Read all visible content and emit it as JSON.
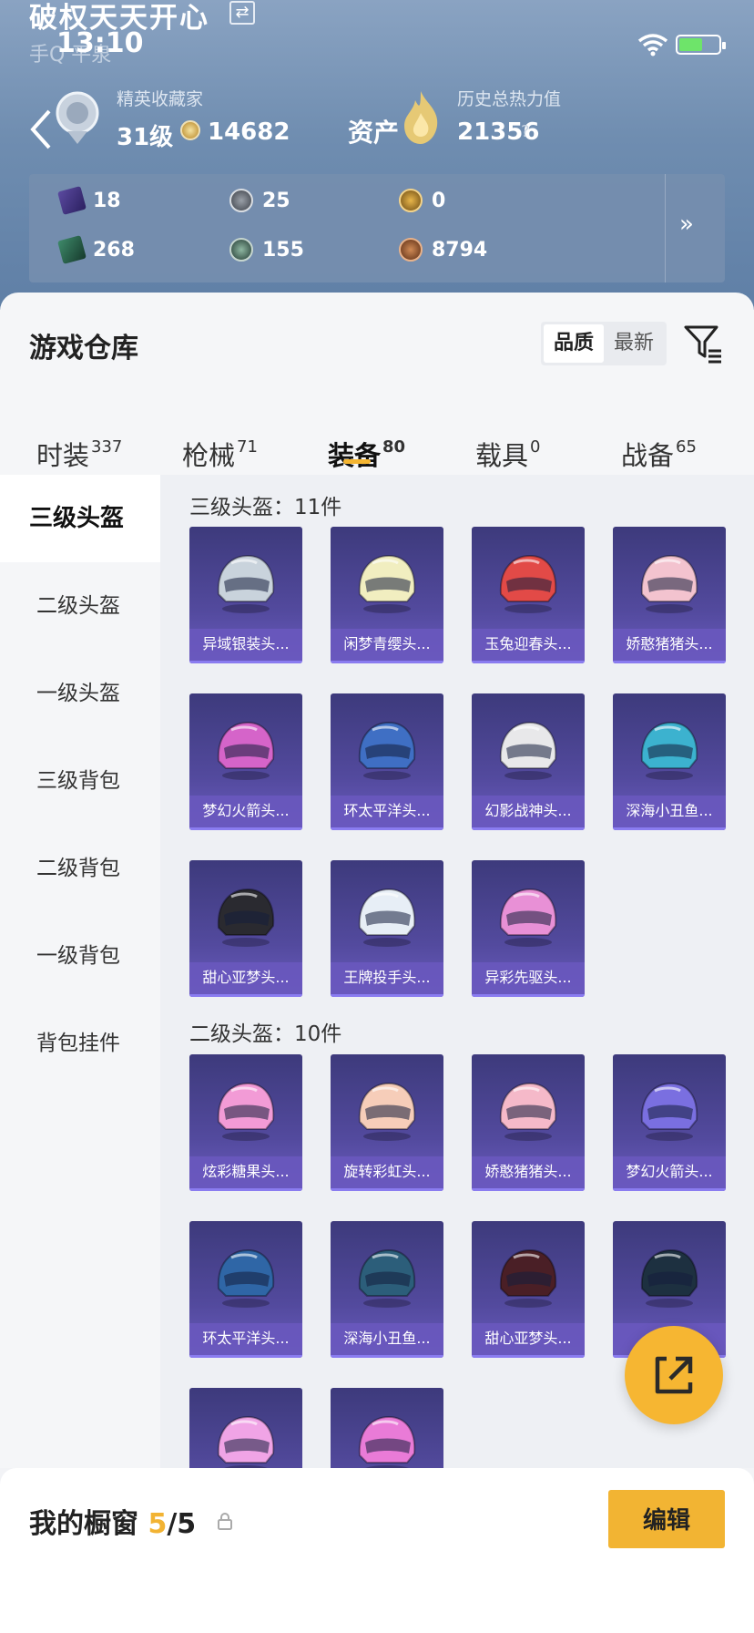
{
  "status_bar": {
    "time": "13:10"
  },
  "header": {
    "title": "破权天天开心",
    "subtitle": "手Q 平泉",
    "rank_label": "精英收藏家",
    "level": "31级",
    "coins": "14682",
    "asset_label": "资产",
    "heat_label": "历史总热力值",
    "heat_value": "21356",
    "help": "?"
  },
  "stats": [
    {
      "icon": "purple-card-icon",
      "value": "18"
    },
    {
      "icon": "silver-coin-icon",
      "value": "25"
    },
    {
      "icon": "gold-badge-icon",
      "value": "0"
    },
    {
      "icon": "green-card-icon",
      "value": "268"
    },
    {
      "icon": "green-orb-icon",
      "value": "155"
    },
    {
      "icon": "bronze-coin-icon",
      "value": "8794"
    }
  ],
  "stats_more": "»",
  "warehouse": {
    "title": "游戏仓库",
    "sort": [
      "品质",
      "最新"
    ],
    "tabs": [
      {
        "label": "时装",
        "count": "337"
      },
      {
        "label": "枪械",
        "count": "71"
      },
      {
        "label": "装备",
        "count": "80"
      },
      {
        "label": "载具",
        "count": "0"
      },
      {
        "label": "战备",
        "count": "65"
      }
    ],
    "sidebar": [
      "三级头盔",
      "二级头盔",
      "一级头盔",
      "三级背包",
      "二级背包",
      "一级背包",
      "背包挂件"
    ],
    "sections": [
      {
        "title": "三级头盔：11件",
        "items": [
          "异域银装头...",
          "闲梦青缨头...",
          "玉兔迎春头...",
          "娇憨猪猪头...",
          "梦幻火箭头...",
          "环太平洋头...",
          "幻影战神头...",
          "深海小丑鱼...",
          "甜心亚梦头...",
          "王牌投手头...",
          "异彩先驱头..."
        ]
      },
      {
        "title": "二级头盔：10件",
        "items": [
          "炫彩糖果头...",
          "旋转彩虹头...",
          "娇憨猪猪头...",
          "梦幻火箭头...",
          "环太平洋头...",
          "深海小丑鱼...",
          "甜心亚梦头...",
          "炫...",
          "",
          ""
        ]
      }
    ]
  },
  "colors": {
    "accent": "#f2b433",
    "card_top": "#3d3a7c",
    "card_bottom": "#6b5cc0",
    "helmets": [
      "#c9d3dc",
      "#f1eec0",
      "#e24a47",
      "#f3c3cf",
      "#d564c9",
      "#3f6fc4",
      "#e8e8ea",
      "#3cb2cf",
      "#2a2a30",
      "#e7eef6",
      "#e890d6",
      "#f29bd6",
      "#f6cdb9",
      "#f5b9c9",
      "#7a6fe0",
      "#2f66a6",
      "#2c5e7a",
      "#4a1f26",
      "#1d3040",
      "#f0a4e6",
      "#e97bd7"
    ]
  },
  "showcase": {
    "title": "我的橱窗",
    "current": "5",
    "total": "/5",
    "edit_label": "编辑"
  }
}
